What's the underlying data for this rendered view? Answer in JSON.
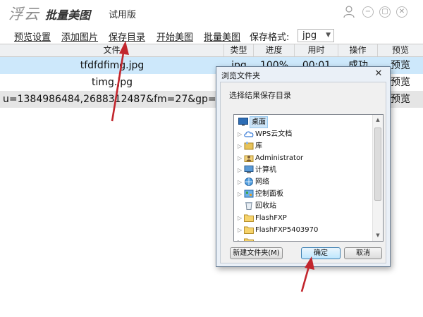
{
  "app": {
    "logo_text": "浮云",
    "name": "批量美图",
    "edition": "试用版"
  },
  "window_controls": {
    "user_icon": "user-icon",
    "minimize_icon": "minimize-icon",
    "maximize_icon": "maximize-icon",
    "close_icon": "close-icon"
  },
  "menu": {
    "items": [
      {
        "label": "预览设置"
      },
      {
        "label": "添加图片"
      },
      {
        "label": "保存目录"
      },
      {
        "label": "开始美图"
      },
      {
        "label": "批量美图"
      }
    ],
    "format_label": "保存格式:",
    "format_value": "jpg"
  },
  "table": {
    "columns": [
      "文件",
      "类型",
      "进度",
      "用时",
      "操作",
      "预览"
    ],
    "rows": [
      {
        "file": "tfdfdfimg.jpg",
        "type": "jpg",
        "progress": "100%",
        "time": "00:01",
        "op": "成功",
        "preview": "预览"
      },
      {
        "file": "timg.jpg",
        "type": "",
        "progress": "",
        "time": "",
        "op": "",
        "preview": "预览"
      },
      {
        "file": "u=1384986484,2688312487&fm=27&gp=0.j...",
        "type": "",
        "progress": "",
        "time": "",
        "op": "",
        "preview": "预览"
      }
    ]
  },
  "dialog": {
    "title": "浏览文件夹",
    "instruction": "选择结果保存目录",
    "tree": [
      {
        "label": "桌面",
        "icon": "desktop-icon"
      },
      {
        "label": "WPS云文档",
        "icon": "cloud-icon"
      },
      {
        "label": "库",
        "icon": "library-icon"
      },
      {
        "label": "Administrator",
        "icon": "user-folder-icon"
      },
      {
        "label": "计算机",
        "icon": "computer-icon"
      },
      {
        "label": "网络",
        "icon": "network-icon"
      },
      {
        "label": "控制面板",
        "icon": "control-panel-icon"
      },
      {
        "label": "回收站",
        "icon": "recycle-bin-icon"
      },
      {
        "label": "FlashFXP",
        "icon": "folder-icon"
      },
      {
        "label": "FlashFXP5403970",
        "icon": "folder-icon"
      }
    ],
    "buttons": {
      "new_folder": "新建文件夹(M)",
      "ok": "确定",
      "cancel": "取消"
    }
  },
  "colors": {
    "selected_row": "#cde8fb",
    "highlight_row": "#e5e5e5",
    "header_bg": "#eef0f2",
    "arrow": "#c2262d",
    "dialog_frame": "#eaf0f7",
    "tree_selection": "#cce4f7"
  }
}
